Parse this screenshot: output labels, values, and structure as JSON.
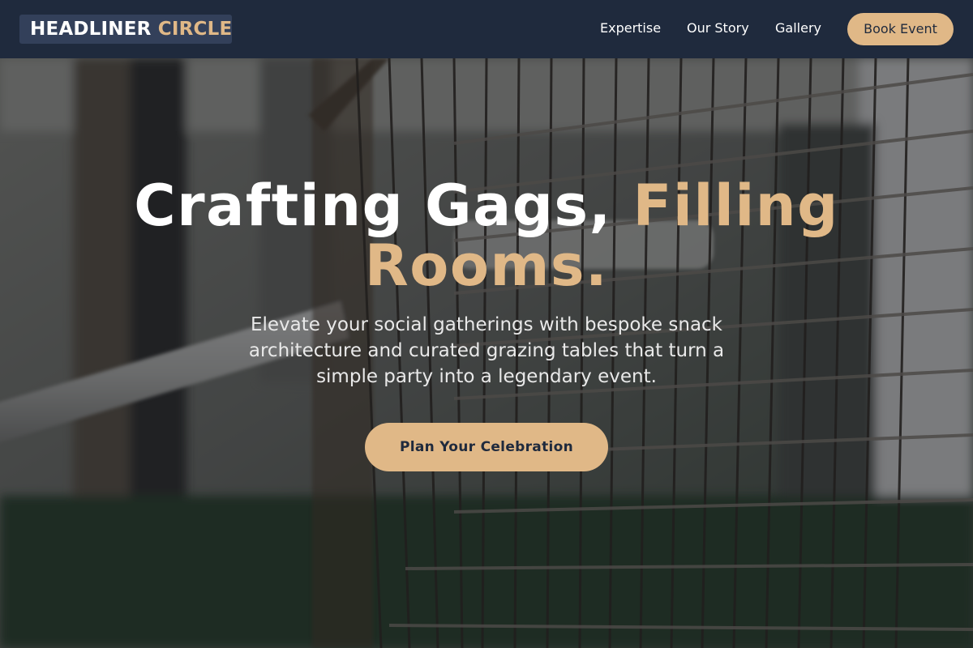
{
  "brand": {
    "name_part1": "HEADLINER",
    "name_part2": "CIRCLE"
  },
  "nav": {
    "links": [
      "Expertise",
      "Our Story",
      "Gallery"
    ],
    "cta_label": "Book Event"
  },
  "hero": {
    "title_part1": "Crafting Gags,",
    "title_part2": "Filling Rooms.",
    "subtitle": "Elevate your social gatherings with bespoke snack architecture and curated grazing tables that turn a simple party into a legendary event.",
    "cta_label": "Plan Your Celebration"
  },
  "colors": {
    "navy": "#1f2a3d",
    "accent": "#e0b887",
    "white": "#ffffff"
  }
}
